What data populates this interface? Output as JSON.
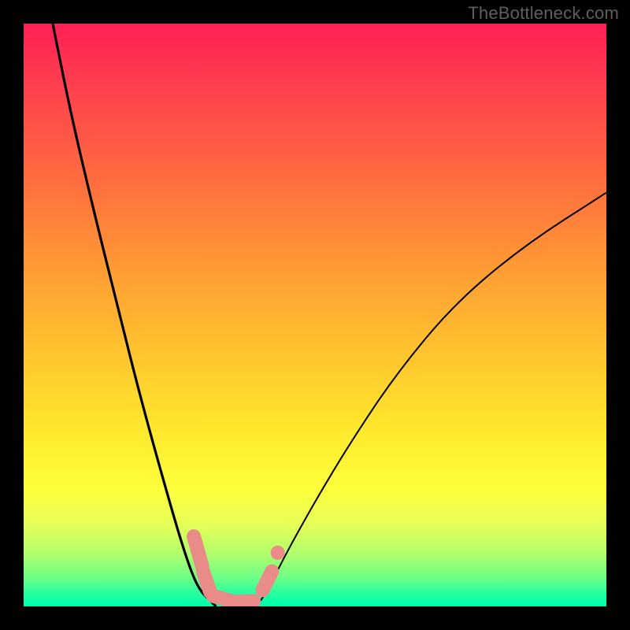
{
  "watermark": "TheBottleneck.com",
  "colors": {
    "frame": "#000000",
    "curve": "#000000",
    "marker_fill": "#e98b87",
    "marker_stroke": "#d07a76",
    "gradient_stops": [
      "#ff1f56",
      "#ff3850",
      "#ff5945",
      "#ff7c3b",
      "#ffa433",
      "#ffc82e",
      "#ffe92e",
      "#fdff3d",
      "#e6ff58",
      "#b0ff6c",
      "#6fff85",
      "#22ffa0",
      "#00ffb0"
    ]
  },
  "chart_data": {
    "type": "line",
    "title": "",
    "xlabel": "",
    "ylabel": "",
    "xlim": [
      0,
      100
    ],
    "ylim": [
      0,
      100
    ],
    "grid": false,
    "series": [
      {
        "name": "left-curve",
        "x": [
          5,
          8,
          12,
          16,
          20,
          25,
          28,
          30,
          32,
          33
        ],
        "values": [
          100,
          85,
          68,
          52,
          36,
          18,
          8,
          3,
          1,
          0
        ]
      },
      {
        "name": "right-curve",
        "x": [
          40,
          42,
          45,
          50,
          56,
          64,
          74,
          86,
          100
        ],
        "values": [
          0,
          3,
          9,
          18,
          28,
          40,
          52,
          62,
          71
        ]
      }
    ],
    "markers": [
      {
        "type": "pill",
        "x1": 29.2,
        "y1": 12.0,
        "x2": 30.6,
        "y2": 7.0
      },
      {
        "type": "pill",
        "x1": 30.8,
        "y1": 6.0,
        "x2": 32.0,
        "y2": 2.5
      },
      {
        "type": "pill",
        "x1": 32.5,
        "y1": 1.8,
        "x2": 36.0,
        "y2": 0.8
      },
      {
        "type": "pill",
        "x1": 36.5,
        "y1": 0.8,
        "x2": 39.5,
        "y2": 0.9
      },
      {
        "type": "pill",
        "x1": 41.0,
        "y1": 2.8,
        "x2": 42.6,
        "y2": 6.0
      },
      {
        "type": "dot",
        "x": 43.6,
        "y": 9.2
      }
    ]
  }
}
